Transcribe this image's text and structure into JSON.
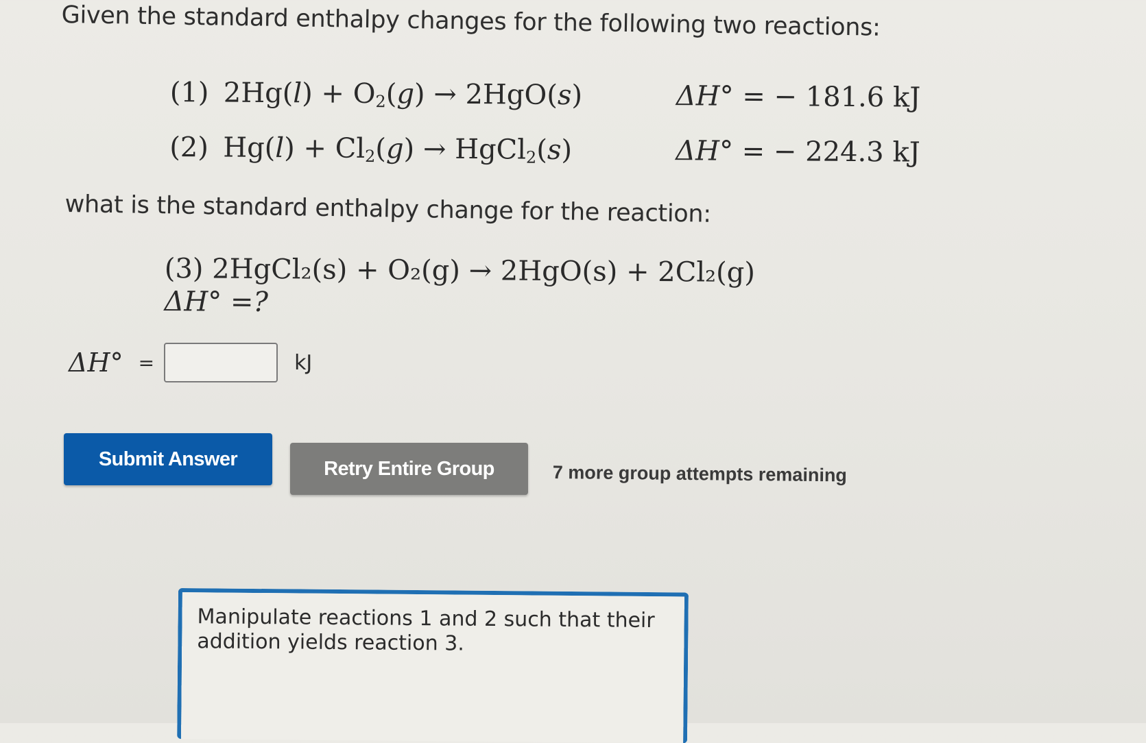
{
  "question": {
    "intro": "Given the standard enthalpy changes for the following two reactions:",
    "reactions": [
      {
        "number": "(1)",
        "equation_parts": [
          "2Hg(",
          "l",
          ") + O",
          "2",
          "(",
          "g",
          ") → 2HgO(",
          "s",
          ")"
        ],
        "delta_h_label": "ΔH° =",
        "delta_h_value": "− 181.6 kJ"
      },
      {
        "number": "(2)",
        "equation_parts": [
          "Hg(",
          "l",
          ") + Cl",
          "2",
          "(",
          "g",
          ") → HgCl",
          "2",
          "(",
          "s",
          ")"
        ],
        "delta_h_label": "ΔH° =",
        "delta_h_value": "− 224.3 kJ"
      }
    ],
    "prompt": "what is the standard enthalpy change for the reaction:",
    "target_reaction": {
      "number": "(3)",
      "equation": "2HgCl₂(s) + O₂(g) → 2HgO(s) + 2Cl₂(g)",
      "delta_h_query": "ΔH° =?"
    }
  },
  "answer": {
    "label": "ΔH°",
    "equals": "=",
    "value": "",
    "unit": "kJ"
  },
  "buttons": {
    "submit": "Submit Answer",
    "retry": "Retry Entire Group"
  },
  "attempts_text": "7 more group attempts remaining",
  "hint": "Manipulate reactions 1 and 2 such that their addition yields reaction 3."
}
